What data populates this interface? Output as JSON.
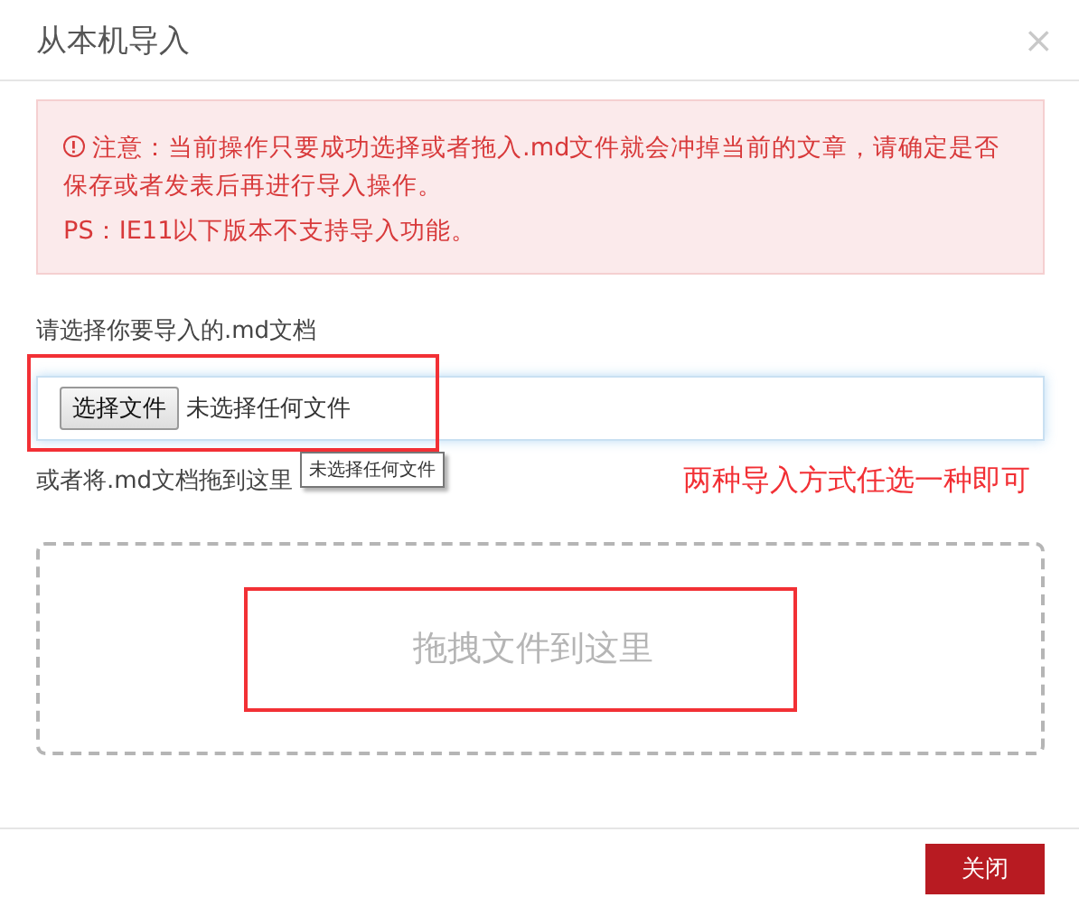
{
  "dialog": {
    "title": "从本机导入",
    "close": "×"
  },
  "alert": {
    "lines": [
      "注意：当前操作只要成功选择或者拖入.md文件就会冲掉当前的文章，请确定是否保存或者发表后再进行导入操作。",
      "PS：IE11以下版本不支持导入功能。"
    ]
  },
  "file_label": "请选择你要导入的.md文档",
  "file_input": {
    "button": "选择文件",
    "status": "未选择任何文件"
  },
  "drag_label": "或者将.md文档拖到这里",
  "tooltip": "未选择任何文件",
  "annotation": "两种导入方式任选一种即可",
  "drop_zone": {
    "text": "拖拽文件到这里"
  },
  "buttons": [
    {
      "label": "关闭",
      "kind": "primary"
    }
  ]
}
